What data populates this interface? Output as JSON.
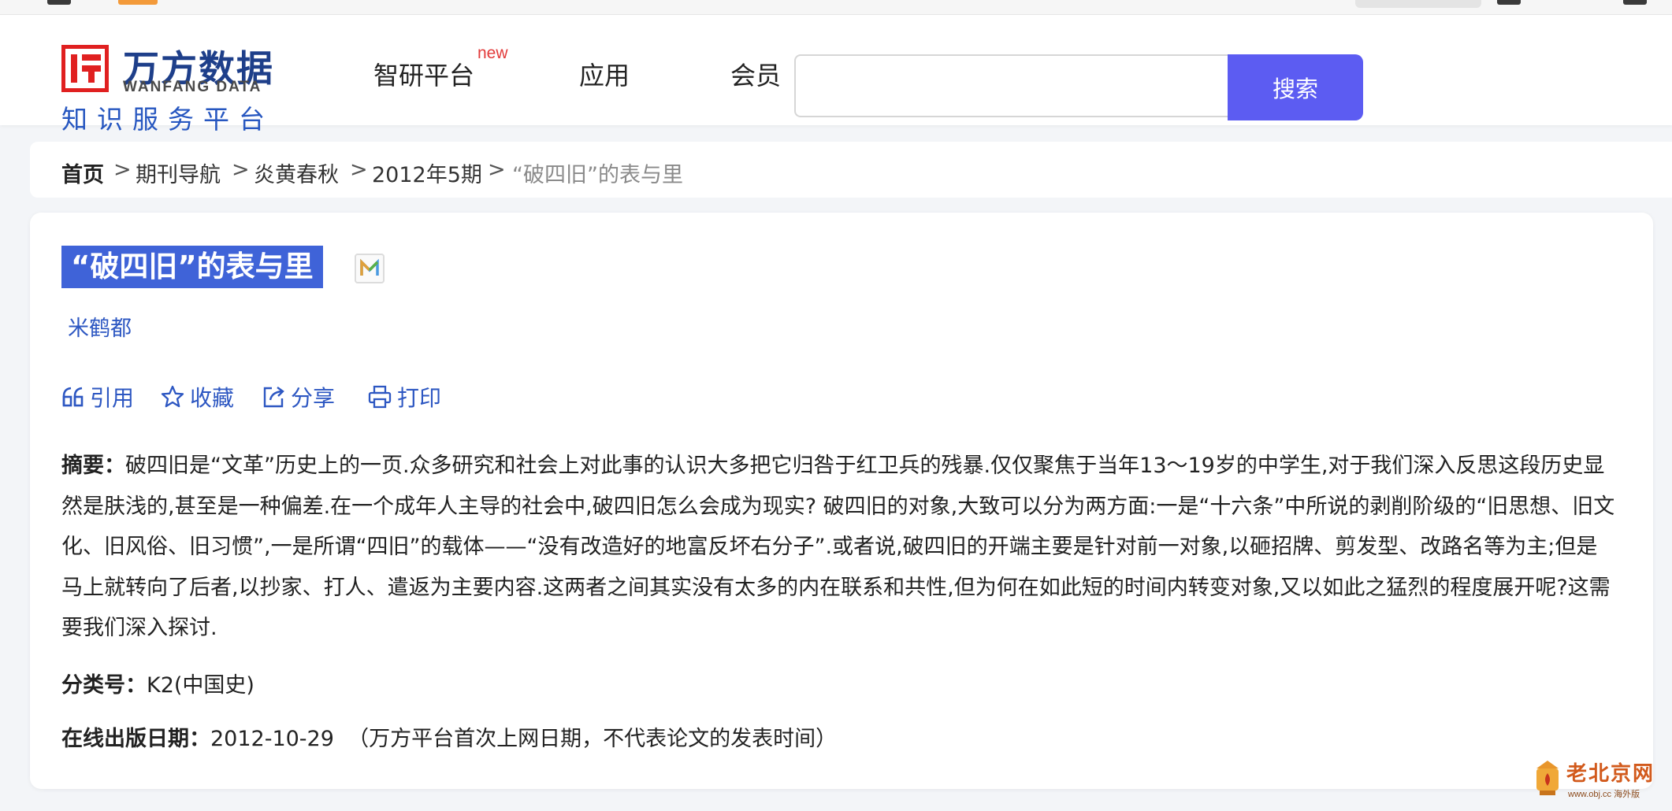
{
  "header": {
    "logo": {
      "name_cn": "万方数据",
      "name_en": "WANFANG DATA",
      "slogan": "知识服务平台"
    },
    "nav": {
      "zhiyan": "智研平台",
      "zhiyan_badge": "new",
      "apps": "应用",
      "member": "会员"
    },
    "search": {
      "value": "",
      "placeholder": "",
      "button_label": "搜索"
    }
  },
  "breadcrumb": {
    "home": "首页",
    "journal_nav": "期刊导航",
    "journal": "炎黄春秋",
    "issue": "2012年5期",
    "current": "“破四旧”的表与里",
    "separator": ">"
  },
  "article": {
    "title": "“破四旧”的表与里",
    "title_badge_icon": "m-badge-icon",
    "author": "米鹤都",
    "actions": {
      "cite": "引用",
      "favorite": "收藏",
      "share": "分享",
      "print": "打印"
    },
    "abstract_label": "摘要：",
    "abstract": "破四旧是“文革”历史上的一页.众多研究和社会上对此事的认识大多把它归咎于红卫兵的残暴.仅仅聚焦于当年13～19岁的中学生,对于我们深入反思这段历史显然是肤浅的,甚至是一种偏差.在一个成年人主导的社会中,破四旧怎么会成为现实? 破四旧的对象,大致可以分为两方面:一是“十六条”中所说的剥削阶级的“旧思想、旧文化、旧风俗、旧习惯”,一是所谓“四旧”的载体——“没有改造好的地富反坏右分子”.或者说,破四旧的开端主要是针对前一对象,以砸招牌、剪发型、改路名等为主;但是马上就转向了后者,以抄家、打人、遣返为主要内容.这两者之间其实没有太多的内在联系和共性,但为何在如此短的时间内转变对象,又以如此之猛烈的程度展开呢?这需要我们深入探讨.",
    "class_label": "分类号：",
    "class_value": "K2(中国史)",
    "date_label": "在线出版日期：",
    "date_value": "2012-10-29",
    "date_note": "（万方平台首次上网日期，不代表论文的发表时间）"
  },
  "watermark": {
    "text": "老北京网",
    "url": "www.obj.cc 海外版"
  },
  "colors": {
    "brand_blue": "#2757c0",
    "title_bg": "#3f63d8",
    "search_button": "#5c5cf2",
    "new_badge": "#e23b3b",
    "logo_red": "#e02020"
  }
}
